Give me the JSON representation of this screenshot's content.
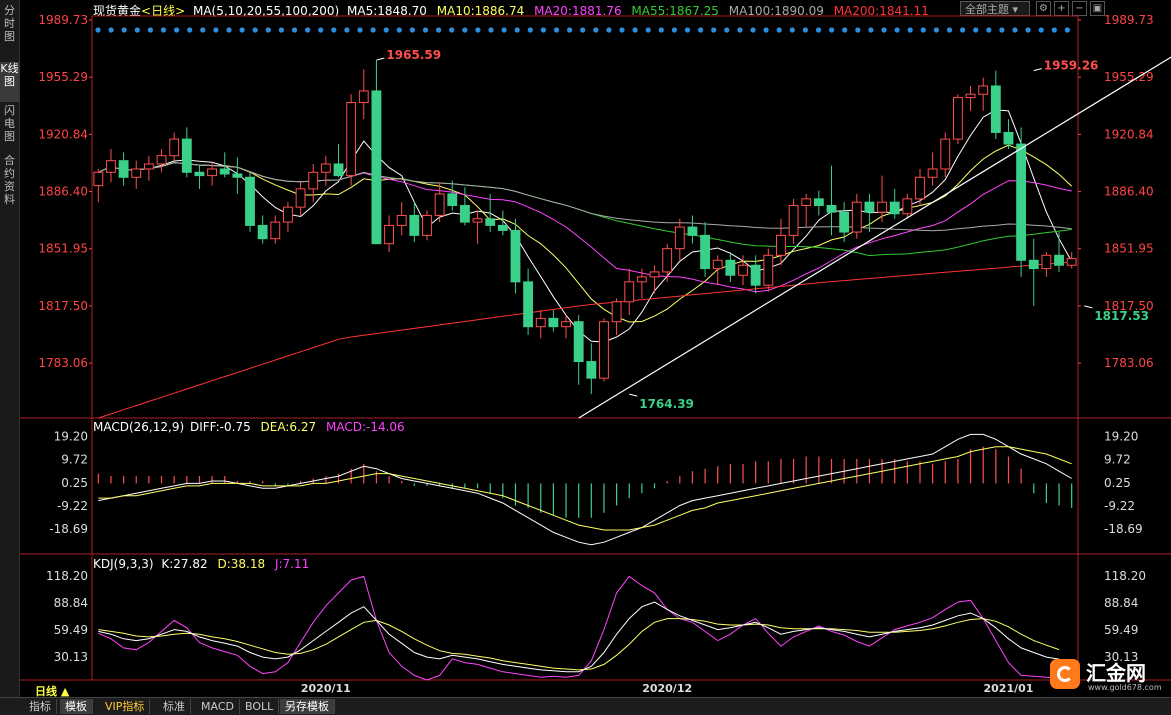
{
  "sidebar": {
    "tabs": [
      {
        "label": "分时图",
        "active": false
      },
      {
        "label": "K线图",
        "active": true
      },
      {
        "label": "闪电图",
        "active": false
      },
      {
        "label": "合约资料",
        "active": false
      }
    ]
  },
  "header": {
    "symbol": "现货黄金",
    "period": "<日线>",
    "ma_label": "MA(5,10,20,55,100,200)",
    "ma5": "MA5:1848.70",
    "ma10": "MA10:1886.74",
    "ma20": "MA20:1881.76",
    "ma55": "MA55:1867.25",
    "ma100": "MA100:1890.09",
    "ma200": "MA200:1841.11",
    "theme_select": "全部主题",
    "icons": [
      "settings-icon",
      "zoom-in-icon",
      "zoom-out-icon",
      "fullscreen-icon"
    ]
  },
  "colors": {
    "up": "#ff4e4e",
    "down": "#3ad08a",
    "ma5": "#ffffff",
    "ma10": "#ffff66",
    "ma20": "#ff44ff",
    "ma55": "#33cc33",
    "ma100": "#aaaaaa",
    "ma200": "#ff3333",
    "axis": "#ff4444",
    "macd_diff": "#ffffff",
    "macd_dea": "#ffff66",
    "kdj_k": "#ffffff",
    "kdj_d": "#ffff66",
    "kdj_j": "#ff44ff"
  },
  "chart_data": [
    {
      "type": "candlestick",
      "title": "现货黄金 <日线>",
      "y_ticks": [
        "1989.73",
        "1955.29",
        "1920.84",
        "1886.40",
        "1851.95",
        "1817.50",
        "1783.06"
      ],
      "ylim": [
        1750,
        1989.73
      ],
      "x_ticks": [
        {
          "label": "2020/11",
          "index": 18
        },
        {
          "label": "2020/12",
          "index": 45
        },
        {
          "label": "2021/01",
          "index": 72
        }
      ],
      "annotations": [
        {
          "text": "1965.59",
          "index": 22,
          "value": 1965.59,
          "color": "up"
        },
        {
          "text": "1764.39",
          "index": 42,
          "value": 1764.39,
          "color": "down"
        },
        {
          "text": "1959.26",
          "index": 74,
          "value": 1959.26,
          "color": "up"
        },
        {
          "text": "1817.53",
          "index": 78,
          "value": 1817.53,
          "color": "down"
        }
      ],
      "trendline": [
        {
          "index": 38,
          "value": 1750
        },
        {
          "index": 85,
          "value": 1968
        }
      ],
      "ohlc": [
        [
          1890,
          1900,
          1880,
          1898
        ],
        [
          1898,
          1912,
          1892,
          1905
        ],
        [
          1905,
          1910,
          1890,
          1895
        ],
        [
          1895,
          1905,
          1888,
          1900
        ],
        [
          1900,
          1908,
          1893,
          1903
        ],
        [
          1903,
          1912,
          1898,
          1908
        ],
        [
          1908,
          1922,
          1905,
          1918
        ],
        [
          1918,
          1925,
          1895,
          1898
        ],
        [
          1898,
          1902,
          1888,
          1896
        ],
        [
          1896,
          1904,
          1890,
          1900
        ],
        [
          1900,
          1910,
          1895,
          1897
        ],
        [
          1897,
          1907,
          1885,
          1895
        ],
        [
          1895,
          1898,
          1862,
          1866
        ],
        [
          1866,
          1872,
          1855,
          1858
        ],
        [
          1858,
          1872,
          1855,
          1868
        ],
        [
          1868,
          1880,
          1862,
          1877
        ],
        [
          1877,
          1892,
          1872,
          1888
        ],
        [
          1888,
          1903,
          1880,
          1898
        ],
        [
          1898,
          1908,
          1890,
          1903
        ],
        [
          1903,
          1915,
          1895,
          1896
        ],
        [
          1896,
          1945,
          1890,
          1940
        ],
        [
          1940,
          1960,
          1930,
          1947
        ],
        [
          1947,
          1965.59,
          1855,
          1855
        ],
        [
          1855,
          1872,
          1850,
          1866
        ],
        [
          1866,
          1880,
          1860,
          1872
        ],
        [
          1872,
          1880,
          1856,
          1860
        ],
        [
          1860,
          1875,
          1857,
          1872
        ],
        [
          1872,
          1892,
          1868,
          1885
        ],
        [
          1885,
          1893,
          1875,
          1878
        ],
        [
          1878,
          1889,
          1866,
          1868
        ],
        [
          1868,
          1875,
          1855,
          1870
        ],
        [
          1870,
          1885,
          1862,
          1866
        ],
        [
          1866,
          1875,
          1860,
          1863
        ],
        [
          1863,
          1870,
          1825,
          1832
        ],
        [
          1832,
          1840,
          1800,
          1805
        ],
        [
          1805,
          1815,
          1798,
          1810
        ],
        [
          1810,
          1815,
          1802,
          1805
        ],
        [
          1805,
          1812,
          1798,
          1808
        ],
        [
          1808,
          1812,
          1770,
          1784
        ],
        [
          1784,
          1795,
          1764.39,
          1774
        ],
        [
          1774,
          1810,
          1772,
          1808
        ],
        [
          1808,
          1822,
          1800,
          1820
        ],
        [
          1820,
          1840,
          1812,
          1832
        ],
        [
          1832,
          1840,
          1822,
          1835
        ],
        [
          1835,
          1842,
          1825,
          1838
        ],
        [
          1838,
          1855,
          1832,
          1852
        ],
        [
          1852,
          1870,
          1845,
          1865
        ],
        [
          1865,
          1872,
          1855,
          1860
        ],
        [
          1860,
          1868,
          1835,
          1840
        ],
        [
          1840,
          1848,
          1830,
          1845
        ],
        [
          1845,
          1850,
          1832,
          1836
        ],
        [
          1836,
          1848,
          1830,
          1842
        ],
        [
          1842,
          1848,
          1825,
          1830
        ],
        [
          1830,
          1852,
          1826,
          1848
        ],
        [
          1848,
          1870,
          1842,
          1860
        ],
        [
          1860,
          1882,
          1855,
          1878
        ],
        [
          1878,
          1885,
          1865,
          1882
        ],
        [
          1882,
          1887,
          1872,
          1878
        ],
        [
          1878,
          1902,
          1860,
          1874
        ],
        [
          1874,
          1880,
          1856,
          1862
        ],
        [
          1862,
          1885,
          1858,
          1880
        ],
        [
          1880,
          1885,
          1862,
          1874
        ],
        [
          1874,
          1896,
          1868,
          1880
        ],
        [
          1880,
          1888,
          1870,
          1873
        ],
        [
          1873,
          1885,
          1870,
          1882
        ],
        [
          1882,
          1900,
          1878,
          1895
        ],
        [
          1895,
          1910,
          1890,
          1900
        ],
        [
          1900,
          1922,
          1895,
          1918
        ],
        [
          1918,
          1945,
          1915,
          1943
        ],
        [
          1943,
          1950,
          1935,
          1945
        ],
        [
          1945,
          1955,
          1935,
          1950
        ],
        [
          1950,
          1959.26,
          1918,
          1922
        ],
        [
          1922,
          1930,
          1912,
          1915
        ],
        [
          1915,
          1925,
          1835,
          1845
        ],
        [
          1845,
          1858,
          1817.53,
          1840
        ],
        [
          1840,
          1850,
          1835,
          1848
        ],
        [
          1848,
          1862,
          1838,
          1842
        ],
        [
          1842,
          1850,
          1840,
          1846
        ]
      ],
      "ma200_values": [
        1750,
        1798,
        1818,
        1832,
        1844
      ]
    },
    {
      "type": "macd",
      "label": "MACD(26,12,9)",
      "diff_label": "DIFF:-0.75",
      "dea_label": "DEA:6.27",
      "macd_label": "MACD:-14.06",
      "y_ticks": [
        "19.20",
        "9.72",
        "0.25",
        "-9.22",
        "-18.69"
      ],
      "ylim": [
        -28,
        21
      ],
      "diff": [
        -7,
        -6,
        -5,
        -4,
        -3,
        -2,
        -1,
        0,
        0,
        1,
        1,
        0,
        -1,
        -2,
        -2,
        -1,
        0,
        1,
        2,
        3,
        5,
        7,
        6,
        4,
        2,
        1,
        0,
        -1,
        -2,
        -3,
        -4,
        -6,
        -8,
        -11,
        -14,
        -17,
        -20,
        -22,
        -24,
        -25,
        -24,
        -22,
        -20,
        -18,
        -15,
        -12,
        -9,
        -7,
        -6,
        -5,
        -4,
        -3,
        -2,
        -1,
        0,
        1,
        2,
        3,
        4,
        5,
        6,
        7,
        8,
        9,
        10,
        11,
        12,
        15,
        18,
        20,
        20,
        18,
        15,
        12,
        10,
        8,
        5,
        2,
        0
      ],
      "dea": [
        -6,
        -6,
        -5,
        -5,
        -4,
        -3,
        -2,
        -1,
        -1,
        0,
        0,
        0,
        0,
        -1,
        -1,
        -1,
        -1,
        0,
        0,
        1,
        2,
        3,
        4,
        4,
        3,
        2,
        1,
        0,
        -1,
        -2,
        -3,
        -4,
        -5,
        -7,
        -9,
        -11,
        -13,
        -15,
        -17,
        -18,
        -19,
        -19,
        -19,
        -18,
        -17,
        -15,
        -13,
        -11,
        -10,
        -8,
        -7,
        -6,
        -5,
        -4,
        -3,
        -2,
        -1,
        0,
        1,
        2,
        3,
        4,
        5,
        6,
        7,
        8,
        9,
        10,
        11,
        13,
        14,
        15,
        15,
        14,
        13,
        12,
        10,
        8,
        6
      ],
      "hist": [
        4,
        3,
        3,
        3,
        3,
        3,
        3,
        3,
        3,
        3,
        3,
        1,
        1,
        1,
        -1,
        -1,
        1,
        2,
        3,
        4,
        6,
        8,
        5,
        3,
        1,
        -1,
        -1,
        -1,
        -2,
        -2,
        -2,
        -4,
        -6,
        -9,
        -10,
        -12,
        -13,
        -14,
        -14,
        -14,
        -12,
        -9,
        -6,
        -4,
        -2,
        1,
        3,
        5,
        6,
        7,
        8,
        8,
        9,
        9,
        10,
        10,
        11,
        11,
        10,
        10,
        10,
        10,
        10,
        10,
        9,
        9,
        8,
        9,
        10,
        14,
        15,
        14,
        11,
        6,
        -4,
        -8,
        -9,
        -10,
        -14.06
      ]
    },
    {
      "type": "kdj",
      "label": "KDJ(9,3,3)",
      "k_label": "K:27.82",
      "d_label": "D:38.18",
      "j_label": "J:7.11",
      "y_ticks": [
        "118.20",
        "88.84",
        "59.49",
        "30.13"
      ],
      "ylim": [
        5,
        125
      ],
      "k": [
        58,
        55,
        50,
        48,
        50,
        55,
        60,
        58,
        52,
        48,
        45,
        42,
        35,
        30,
        28,
        30,
        38,
        48,
        58,
        68,
        78,
        85,
        70,
        55,
        45,
        35,
        30,
        28,
        32,
        30,
        28,
        25,
        22,
        20,
        18,
        16,
        15,
        14,
        14,
        20,
        35,
        55,
        72,
        85,
        90,
        82,
        75,
        70,
        65,
        60,
        62,
        65,
        68,
        62,
        55,
        58,
        60,
        62,
        60,
        58,
        55,
        52,
        55,
        58,
        60,
        62,
        65,
        70,
        75,
        78,
        72,
        62,
        50,
        40,
        35,
        30,
        27.82
      ],
      "d": [
        60,
        58,
        56,
        53,
        52,
        53,
        55,
        56,
        55,
        52,
        50,
        47,
        43,
        39,
        35,
        33,
        34,
        38,
        44,
        52,
        60,
        68,
        70,
        65,
        58,
        50,
        43,
        37,
        34,
        33,
        31,
        29,
        26,
        24,
        22,
        20,
        18,
        17,
        16,
        17,
        22,
        32,
        44,
        58,
        68,
        72,
        72,
        71,
        69,
        66,
        65,
        65,
        66,
        65,
        62,
        61,
        61,
        61,
        61,
        60,
        59,
        57,
        57,
        57,
        58,
        59,
        61,
        64,
        68,
        71,
        72,
        69,
        63,
        55,
        48,
        43,
        38.18
      ],
      "j": [
        56,
        50,
        40,
        38,
        46,
        58,
        70,
        62,
        46,
        40,
        36,
        32,
        20,
        12,
        14,
        24,
        46,
        68,
        86,
        100,
        114,
        118,
        70,
        35,
        20,
        10,
        5,
        10,
        28,
        24,
        22,
        18,
        14,
        12,
        10,
        8,
        9,
        8,
        10,
        26,
        60,
        100,
        118,
        108,
        100,
        82,
        72,
        68,
        58,
        48,
        55,
        65,
        72,
        56,
        42,
        52,
        58,
        64,
        58,
        54,
        47,
        42,
        51,
        60,
        64,
        68,
        73,
        82,
        90,
        92,
        72,
        48,
        24,
        10,
        9,
        8,
        7.11
      ]
    }
  ],
  "bottom_tabs": [
    {
      "label": "日线 ▲",
      "active": false,
      "highlight": true
    },
    {
      "label": "指标",
      "active": false
    },
    {
      "label": "模板",
      "active": true
    },
    {
      "label": "VIP指标",
      "active": false,
      "vip": true
    },
    {
      "label": "标准",
      "active": false
    },
    {
      "label": "MACD",
      "active": false
    },
    {
      "label": "BOLL",
      "active": false
    },
    {
      "label": "另存模板",
      "active": true
    }
  ],
  "logo": {
    "text": "汇金网",
    "url_text": "www.gold678.com"
  }
}
